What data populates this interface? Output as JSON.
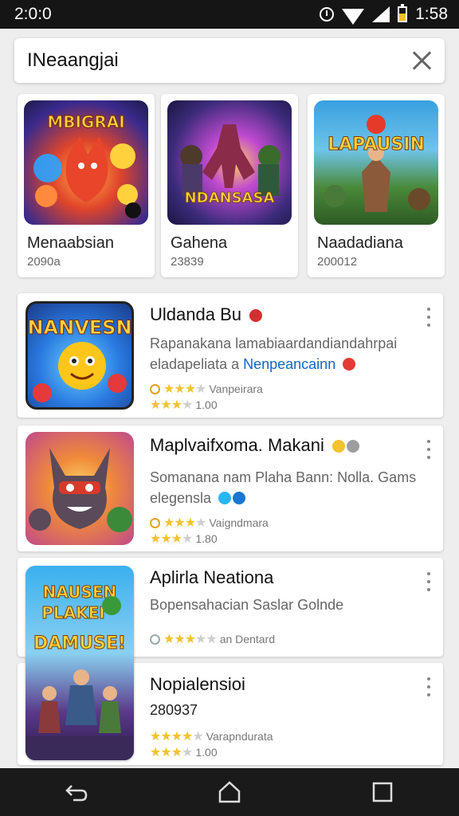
{
  "status": {
    "left_time": "2:0:0",
    "right_time": "1:58"
  },
  "search": {
    "query": "INeaangjai"
  },
  "featured": [
    {
      "name": "Menaabsian",
      "count": "2090a",
      "art": "MBIGRAI"
    },
    {
      "name": "Gahena",
      "count": "23839",
      "art": "NDANSASA"
    },
    {
      "name": "Naadadiana",
      "count": "200012",
      "art": "LAPAUSIN"
    }
  ],
  "apps": [
    {
      "title": "Uldanda Bu",
      "art": "NANVESN",
      "desc1": "Rapanakana lamabiaardandiandahrpai",
      "desc2_prefix": "eladapeliata a ",
      "desc2_link": "Nenpeancainn",
      "rating_label": "Vanpeirara",
      "rating_value": "1.00"
    },
    {
      "title": "Maplvaifxoma. Makani",
      "desc1": "Somanana nam Plaha Bann: Nolla. Gams",
      "desc2_prefix": "elegensla",
      "rating_label": "Vaigndmara",
      "rating_value": "1.80"
    },
    {
      "title": "Aplirla Neationa",
      "art_top": "NAUSEN",
      "art_mid": "PLAKEI",
      "art_bottom": "DAMUSE!",
      "desc1": "Bopensahacian Saslar Golnde",
      "rating_label": "an Dentard"
    },
    {
      "title": "Nopialensioi",
      "count": "280937",
      "rating_label": "Varapndurata",
      "rating_value": "1.00"
    }
  ],
  "colors": {
    "accent_star": "#f2c230",
    "link": "#1565c0",
    "nav_bg": "#1a1a1a"
  }
}
